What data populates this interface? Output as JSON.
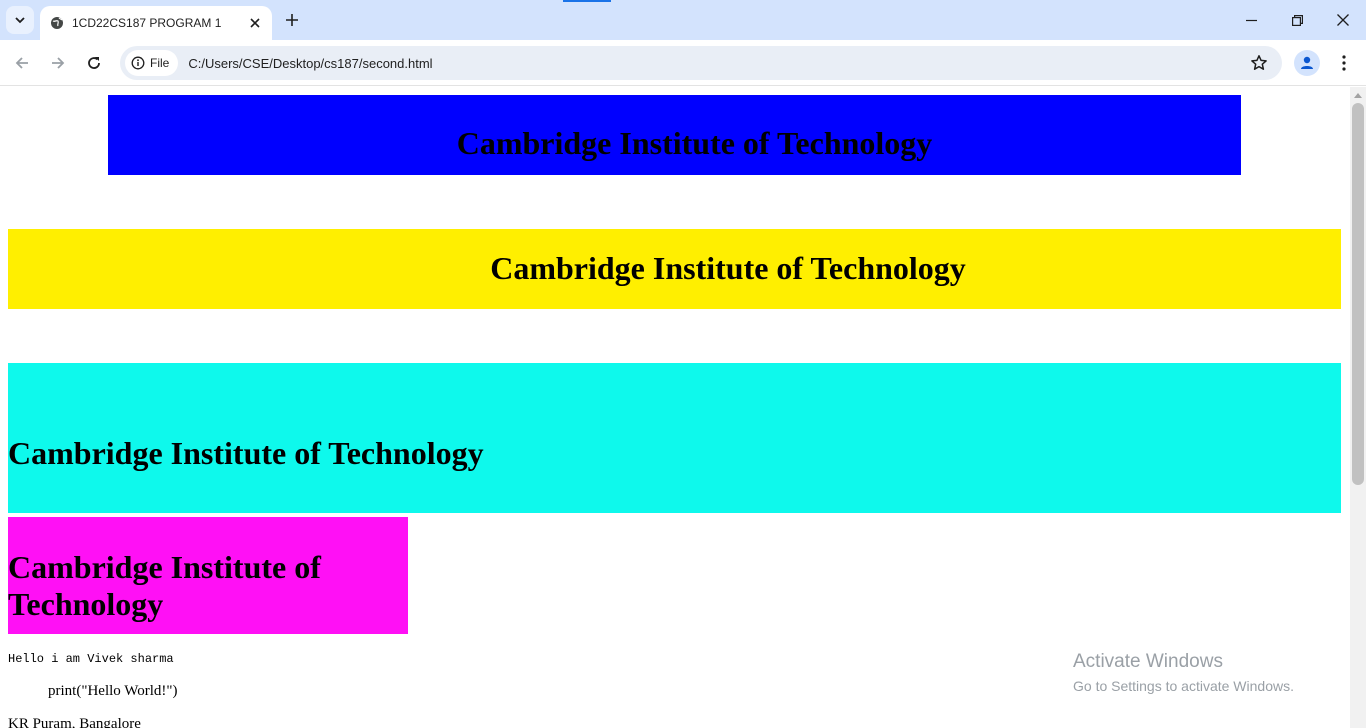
{
  "browser": {
    "tab_title": "1CD22CS187 PROGRAM 1",
    "security_chip": "File",
    "url": "C:/Users/CSE/Desktop/cs187/second.html"
  },
  "page": {
    "heading_1": "Cambridge Institute of Technology",
    "heading_2": "Cambridge Institute of Technology",
    "heading_3": "Cambridge Institute of Technology",
    "heading_4": "Cambridge Institute of Technology",
    "code_text": "Hello i am Vivek sharma",
    "pre_text": "print(\"Hello World!\")",
    "address_text": "KR Puram, Bangalore"
  },
  "watermark": {
    "title": "Activate Windows",
    "subtitle": "Go to Settings to activate Windows."
  },
  "colors": {
    "banner_1": "#0000ff",
    "banner_2": "#ffef00",
    "banner_3": "#0ef9ec",
    "banner_4": "#ff10f5",
    "chrome_accent": "#d3e3fd"
  },
  "icons": [
    "tab-search-icon",
    "globe-icon",
    "close-icon",
    "plus-icon",
    "minimize-icon",
    "restore-icon",
    "window-close-icon",
    "back-icon",
    "forward-icon",
    "reload-icon",
    "info-icon",
    "star-icon",
    "profile-icon",
    "kebab-menu-icon"
  ]
}
